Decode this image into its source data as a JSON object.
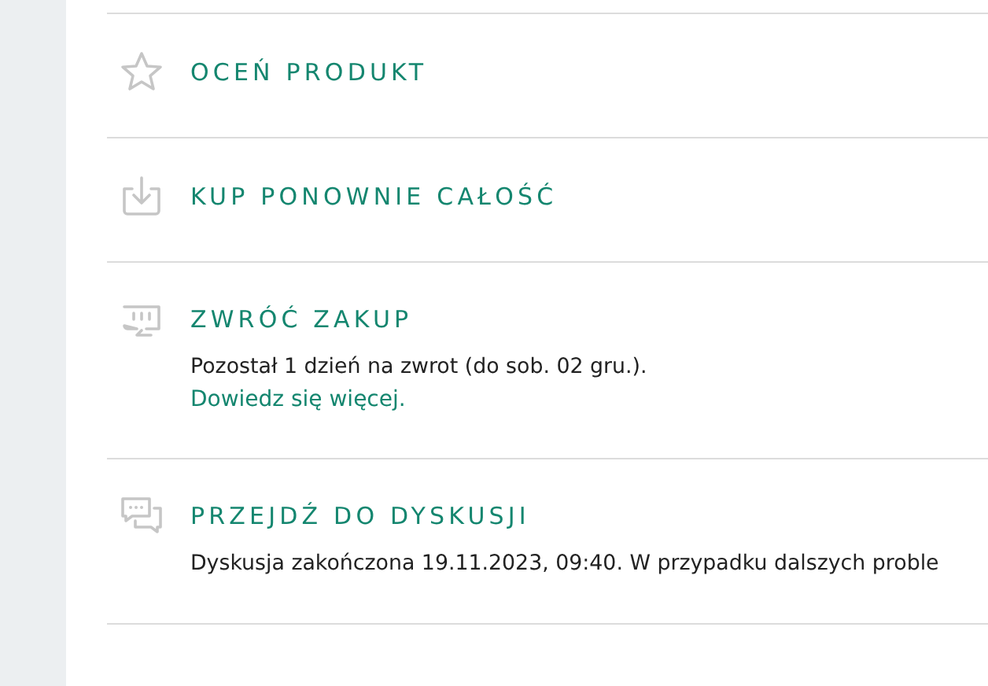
{
  "actions": [
    {
      "kind": "rate",
      "title": "OCEŃ PRODUKT"
    },
    {
      "kind": "rebuy",
      "title": "KUP PONOWNIE CAŁOŚĆ"
    },
    {
      "kind": "return",
      "title": "ZWRÓĆ ZAKUP",
      "text": "Pozostał 1 dzień na zwrot (do sob. 02 gru.).",
      "link": "Dowiedz się więcej."
    },
    {
      "kind": "discussion",
      "title": "PRZEJDŹ DO DYSKUSJI",
      "text": "Dyskusja zakończona 19.11.2023, 09:40. W przypadku dalszych proble"
    }
  ]
}
